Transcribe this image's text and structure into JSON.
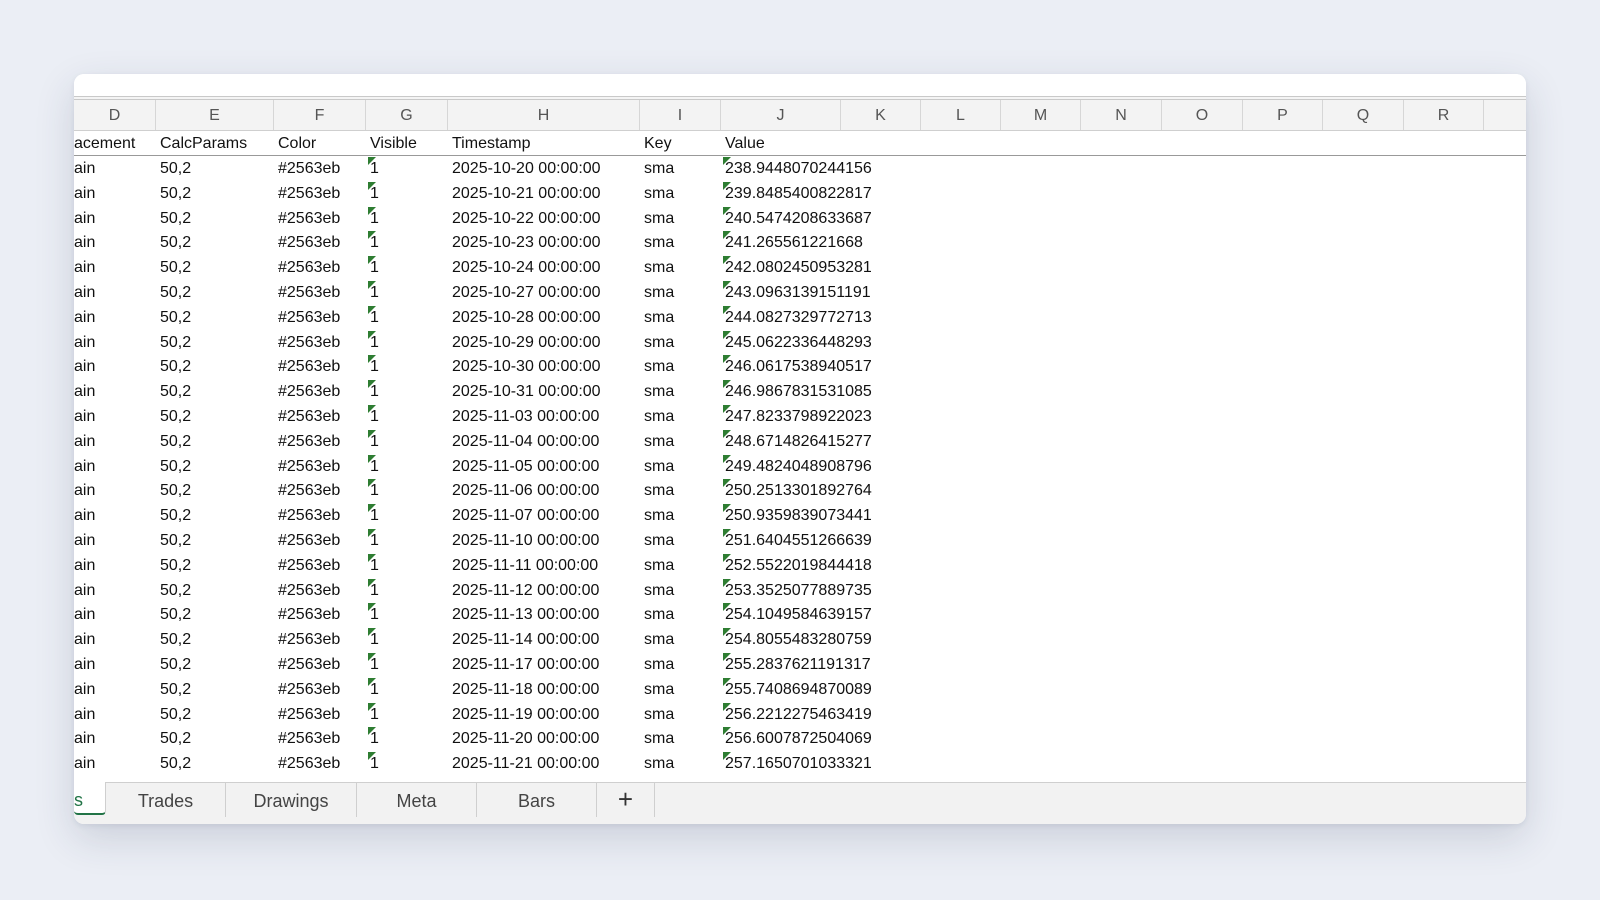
{
  "column_letters": [
    "D",
    "E",
    "F",
    "G",
    "H",
    "I",
    "J",
    "K",
    "L",
    "M",
    "N",
    "O",
    "P",
    "Q",
    "R"
  ],
  "header_row": {
    "placement": "acement",
    "calcparams": "CalcParams",
    "color": "Color",
    "visible": "Visible",
    "timestamp": "Timestamp",
    "key": "Key",
    "value": "Value"
  },
  "rows": [
    {
      "placement": "ain",
      "calcparams": "50,2",
      "color": "#2563eb",
      "visible": "1",
      "timestamp": "2025-10-20 00:00:00",
      "key": "sma",
      "value": "238.9448070244156"
    },
    {
      "placement": "ain",
      "calcparams": "50,2",
      "color": "#2563eb",
      "visible": "1",
      "timestamp": "2025-10-21 00:00:00",
      "key": "sma",
      "value": "239.8485400822817"
    },
    {
      "placement": "ain",
      "calcparams": "50,2",
      "color": "#2563eb",
      "visible": "1",
      "timestamp": "2025-10-22 00:00:00",
      "key": "sma",
      "value": "240.5474208633687"
    },
    {
      "placement": "ain",
      "calcparams": "50,2",
      "color": "#2563eb",
      "visible": "1",
      "timestamp": "2025-10-23 00:00:00",
      "key": "sma",
      "value": "241.265561221668"
    },
    {
      "placement": "ain",
      "calcparams": "50,2",
      "color": "#2563eb",
      "visible": "1",
      "timestamp": "2025-10-24 00:00:00",
      "key": "sma",
      "value": "242.0802450953281"
    },
    {
      "placement": "ain",
      "calcparams": "50,2",
      "color": "#2563eb",
      "visible": "1",
      "timestamp": "2025-10-27 00:00:00",
      "key": "sma",
      "value": "243.0963139151191"
    },
    {
      "placement": "ain",
      "calcparams": "50,2",
      "color": "#2563eb",
      "visible": "1",
      "timestamp": "2025-10-28 00:00:00",
      "key": "sma",
      "value": "244.0827329772713"
    },
    {
      "placement": "ain",
      "calcparams": "50,2",
      "color": "#2563eb",
      "visible": "1",
      "timestamp": "2025-10-29 00:00:00",
      "key": "sma",
      "value": "245.0622336448293"
    },
    {
      "placement": "ain",
      "calcparams": "50,2",
      "color": "#2563eb",
      "visible": "1",
      "timestamp": "2025-10-30 00:00:00",
      "key": "sma",
      "value": "246.0617538940517"
    },
    {
      "placement": "ain",
      "calcparams": "50,2",
      "color": "#2563eb",
      "visible": "1",
      "timestamp": "2025-10-31 00:00:00",
      "key": "sma",
      "value": "246.9867831531085"
    },
    {
      "placement": "ain",
      "calcparams": "50,2",
      "color": "#2563eb",
      "visible": "1",
      "timestamp": "2025-11-03 00:00:00",
      "key": "sma",
      "value": "247.8233798922023"
    },
    {
      "placement": "ain",
      "calcparams": "50,2",
      "color": "#2563eb",
      "visible": "1",
      "timestamp": "2025-11-04 00:00:00",
      "key": "sma",
      "value": "248.6714826415277"
    },
    {
      "placement": "ain",
      "calcparams": "50,2",
      "color": "#2563eb",
      "visible": "1",
      "timestamp": "2025-11-05 00:00:00",
      "key": "sma",
      "value": "249.4824048908796"
    },
    {
      "placement": "ain",
      "calcparams": "50,2",
      "color": "#2563eb",
      "visible": "1",
      "timestamp": "2025-11-06 00:00:00",
      "key": "sma",
      "value": "250.2513301892764"
    },
    {
      "placement": "ain",
      "calcparams": "50,2",
      "color": "#2563eb",
      "visible": "1",
      "timestamp": "2025-11-07 00:00:00",
      "key": "sma",
      "value": "250.9359839073441"
    },
    {
      "placement": "ain",
      "calcparams": "50,2",
      "color": "#2563eb",
      "visible": "1",
      "timestamp": "2025-11-10 00:00:00",
      "key": "sma",
      "value": "251.6404551266639"
    },
    {
      "placement": "ain",
      "calcparams": "50,2",
      "color": "#2563eb",
      "visible": "1",
      "timestamp": "2025-11-11 00:00:00",
      "key": "sma",
      "value": "252.5522019844418"
    },
    {
      "placement": "ain",
      "calcparams": "50,2",
      "color": "#2563eb",
      "visible": "1",
      "timestamp": "2025-11-12 00:00:00",
      "key": "sma",
      "value": "253.3525077889735"
    },
    {
      "placement": "ain",
      "calcparams": "50,2",
      "color": "#2563eb",
      "visible": "1",
      "timestamp": "2025-11-13 00:00:00",
      "key": "sma",
      "value": "254.1049584639157"
    },
    {
      "placement": "ain",
      "calcparams": "50,2",
      "color": "#2563eb",
      "visible": "1",
      "timestamp": "2025-11-14 00:00:00",
      "key": "sma",
      "value": "254.8055483280759"
    },
    {
      "placement": "ain",
      "calcparams": "50,2",
      "color": "#2563eb",
      "visible": "1",
      "timestamp": "2025-11-17 00:00:00",
      "key": "sma",
      "value": "255.2837621191317"
    },
    {
      "placement": "ain",
      "calcparams": "50,2",
      "color": "#2563eb",
      "visible": "1",
      "timestamp": "2025-11-18 00:00:00",
      "key": "sma",
      "value": "255.7408694870089"
    },
    {
      "placement": "ain",
      "calcparams": "50,2",
      "color": "#2563eb",
      "visible": "1",
      "timestamp": "2025-11-19 00:00:00",
      "key": "sma",
      "value": "256.2212275463419"
    },
    {
      "placement": "ain",
      "calcparams": "50,2",
      "color": "#2563eb",
      "visible": "1",
      "timestamp": "2025-11-20 00:00:00",
      "key": "sma",
      "value": "256.6007872504069"
    },
    {
      "placement": "ain",
      "calcparams": "50,2",
      "color": "#2563eb",
      "visible": "1",
      "timestamp": "2025-11-21 00:00:00",
      "key": "sma",
      "value": "257.1650701033321"
    }
  ],
  "sheet_tabs": [
    {
      "label": "s",
      "active": true
    },
    {
      "label": "Trades",
      "active": false
    },
    {
      "label": "Drawings",
      "active": false
    },
    {
      "label": "Meta",
      "active": false
    },
    {
      "label": "Bars",
      "active": false
    }
  ],
  "add_sheet_label": "+",
  "colors": {
    "accent": "#217346",
    "number_stored_as_text_marker": "#2e7d32"
  }
}
